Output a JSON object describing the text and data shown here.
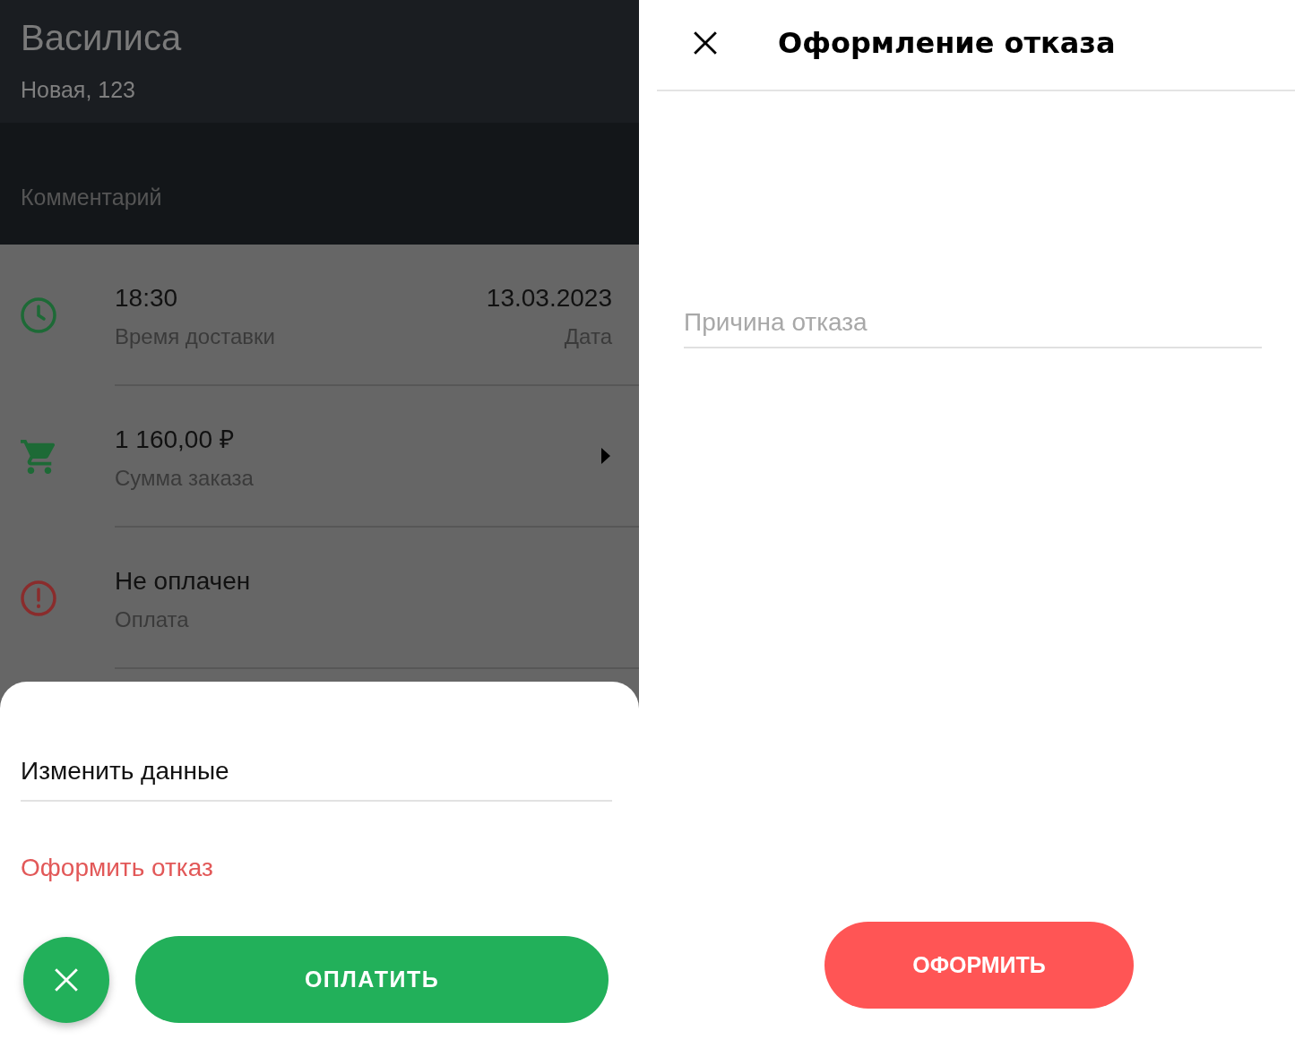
{
  "order_screen": {
    "customer_name": "Василиса",
    "address": "Новая, 123",
    "comment_label": "Комментарий",
    "info_rows": [
      {
        "kind": "time",
        "value": "18:30",
        "label": "Время доставки",
        "aside_value": "13.03.2023",
        "aside_label": "Дата",
        "has_details": false
      },
      {
        "kind": "cart",
        "value": "1 160,00 ₽",
        "label": "Сумма заказа",
        "has_details": true
      },
      {
        "kind": "alert",
        "value": "Не оплачен",
        "label": "Оплата",
        "has_details": false
      }
    ]
  },
  "action_sheet": {
    "actions": [
      {
        "kind": "default",
        "label": "Изменить данные"
      },
      {
        "kind": "danger",
        "label": "Оформить отказ"
      }
    ],
    "pay_button": "ОПЛАТИТЬ"
  },
  "refusal_screen": {
    "title": "Оформление отказа",
    "reason_field": {
      "placeholder": "Причина отказа"
    },
    "submit_button": "ОФОРМИТЬ"
  }
}
